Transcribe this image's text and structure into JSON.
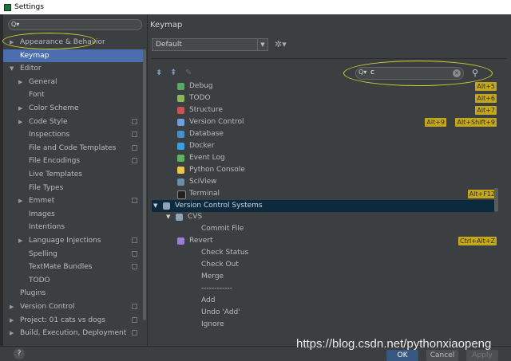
{
  "window": {
    "title": "Settings"
  },
  "sidebar": {
    "search_placeholder": "",
    "items": [
      {
        "label": "Appearance & Behavior",
        "arrow": "▶"
      },
      {
        "label": "Keymap",
        "arrow": ""
      },
      {
        "label": "Editor",
        "arrow": "▼"
      },
      {
        "label": "General",
        "arrow": "▶"
      },
      {
        "label": "Font",
        "arrow": ""
      },
      {
        "label": "Color Scheme",
        "arrow": "▶"
      },
      {
        "label": "Code Style",
        "arrow": "▶"
      },
      {
        "label": "Inspections",
        "arrow": ""
      },
      {
        "label": "File and Code Templates",
        "arrow": ""
      },
      {
        "label": "File Encodings",
        "arrow": ""
      },
      {
        "label": "Live Templates",
        "arrow": ""
      },
      {
        "label": "File Types",
        "arrow": ""
      },
      {
        "label": "Emmet",
        "arrow": "▶"
      },
      {
        "label": "Images",
        "arrow": ""
      },
      {
        "label": "Intentions",
        "arrow": ""
      },
      {
        "label": "Language Injections",
        "arrow": "▶"
      },
      {
        "label": "Spelling",
        "arrow": ""
      },
      {
        "label": "TextMate Bundles",
        "arrow": ""
      },
      {
        "label": "TODO",
        "arrow": ""
      },
      {
        "label": "Plugins",
        "arrow": ""
      },
      {
        "label": "Version Control",
        "arrow": "▶"
      },
      {
        "label": "Project: 01 cats vs dogs",
        "arrow": "▶"
      },
      {
        "label": "Build, Execution, Deployment",
        "arrow": "▶"
      }
    ]
  },
  "main": {
    "title": "Keymap",
    "keymap_select": "Default",
    "search_value": "c",
    "rows": [
      {
        "label": "Debug",
        "icon": "bug-icon",
        "color": "#59a869",
        "shortcuts": [
          "Alt+5"
        ]
      },
      {
        "label": "TODO",
        "icon": "todo-icon",
        "color": "#8fb55e",
        "shortcuts": [
          "Alt+6"
        ]
      },
      {
        "label": "Structure",
        "icon": "structure-icon",
        "color": "#c75450",
        "shortcuts": [
          "Alt+7"
        ]
      },
      {
        "label": "Version Control",
        "icon": "branch-icon",
        "color": "#6e9fd8",
        "shortcuts": [
          "Alt+9",
          "Alt+Shift+9"
        ]
      },
      {
        "label": "Database",
        "icon": "database-icon",
        "color": "#4a90c8",
        "shortcuts": []
      },
      {
        "label": "Docker",
        "icon": "docker-icon",
        "color": "#3ca0e0",
        "shortcuts": []
      },
      {
        "label": "Event Log",
        "icon": "balloon-icon",
        "color": "#5fb35f",
        "shortcuts": []
      },
      {
        "label": "Python Console",
        "icon": "python-icon",
        "color": "#e8c84a",
        "shortcuts": []
      },
      {
        "label": "SciView",
        "icon": "grid-icon",
        "color": "#6b8fa8",
        "shortcuts": []
      },
      {
        "label": "Terminal",
        "icon": "terminal-icon",
        "color": "#222222",
        "shortcuts": [
          "Alt+F12"
        ]
      },
      {
        "label": "Version Control Systems",
        "icon": "folder-icon",
        "color": "#8ea2b8",
        "shortcuts": []
      },
      {
        "label": "CVS",
        "icon": "folder-icon",
        "color": "#8ea2b8",
        "shortcuts": []
      },
      {
        "label": "Commit File",
        "icon": "",
        "color": "",
        "shortcuts": []
      },
      {
        "label": "Revert",
        "icon": "revert-icon",
        "color": "#9b7fd6",
        "shortcuts": [
          "Ctrl+Alt+Z"
        ]
      },
      {
        "label": "Check Status",
        "icon": "",
        "color": "",
        "shortcuts": []
      },
      {
        "label": "Check Out",
        "icon": "",
        "color": "",
        "shortcuts": []
      },
      {
        "label": "Merge",
        "icon": "",
        "color": "",
        "shortcuts": []
      },
      {
        "label": "------------",
        "icon": "",
        "color": "",
        "shortcuts": []
      },
      {
        "label": "Add",
        "icon": "",
        "color": "",
        "shortcuts": []
      },
      {
        "label": "Undo 'Add'",
        "icon": "",
        "color": "",
        "shortcuts": []
      },
      {
        "label": "Ignore",
        "icon": "",
        "color": "",
        "shortcuts": []
      }
    ]
  },
  "footer": {
    "help": "?",
    "ok": "OK",
    "cancel": "Cancel",
    "apply": "Apply"
  },
  "watermark": "https://blog.csdn.net/pythonxiaopeng"
}
